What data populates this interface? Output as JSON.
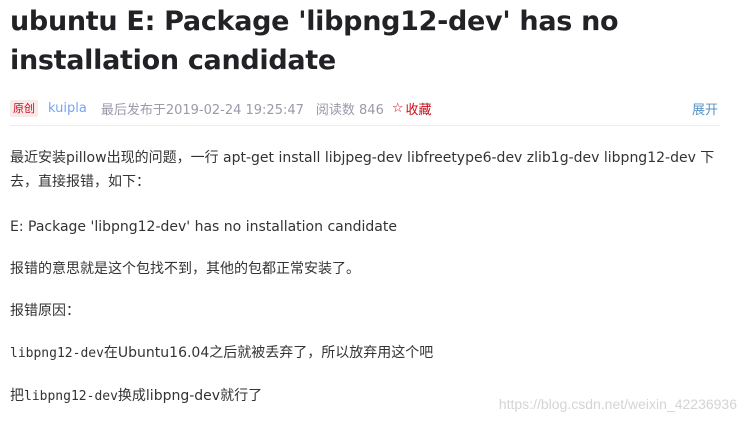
{
  "article": {
    "title": "ubuntu E: Package 'libpng12-dev' has no installation candidate",
    "meta": {
      "badge": "原创",
      "author": "kuipla",
      "time": "最后发布于2019-02-24 19:25:47",
      "reads": "阅读数 846",
      "collect_icon": "star-icon",
      "collect": "收藏",
      "expand": "展开"
    },
    "paragraphs": [
      "最近安装pillow出现的问题，一行 apt-get install libjpeg-dev libfreetype6-dev zlib1g-dev libpng12-dev 下去，直接报错，如下：",
      "E: Package 'libpng12-dev' has no installation candidate",
      "报错的意思就是这个包找不到，其他的包都正常安装了。",
      "报错原因："
    ],
    "line5": {
      "code": "libpng12-dev",
      "text": "在Ubuntu16.04之后就被丢弃了，所以放弃用这个吧"
    },
    "line6": {
      "prefix": "把",
      "code": "libpng12-dev",
      "text": "换成libpng-dev就行了"
    }
  },
  "watermark": "https://blog.csdn.net/weixin_42236936"
}
